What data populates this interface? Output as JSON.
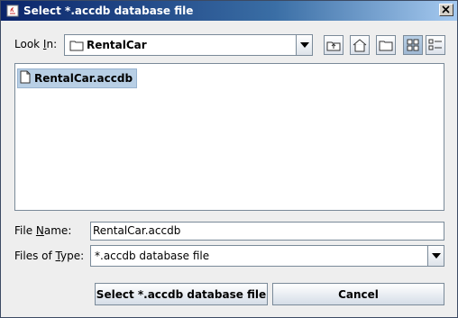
{
  "window": {
    "title": "Select *.accdb database file"
  },
  "lookin": {
    "label_prefix": "Look ",
    "label_mnemonic": "I",
    "label_suffix": "n:",
    "value": "RentalCar"
  },
  "toolbar": {
    "buttons": [
      "up-one-level",
      "home",
      "new-folder",
      "list-view",
      "details-view"
    ]
  },
  "files": [
    {
      "name": "RentalCar.accdb"
    }
  ],
  "filename": {
    "label_prefix": "File ",
    "label_mnemonic": "N",
    "label_suffix": "ame:",
    "value": "RentalCar.accdb"
  },
  "filetype": {
    "label_prefix": "Files of ",
    "label_mnemonic": "T",
    "label_suffix": "ype:",
    "value": "*.accdb database file"
  },
  "buttons": {
    "approve": "Select *.accdb database file",
    "cancel": "Cancel"
  },
  "colors": {
    "title_gradient_start": "#0a246a",
    "selection": "#b8cfe5"
  }
}
